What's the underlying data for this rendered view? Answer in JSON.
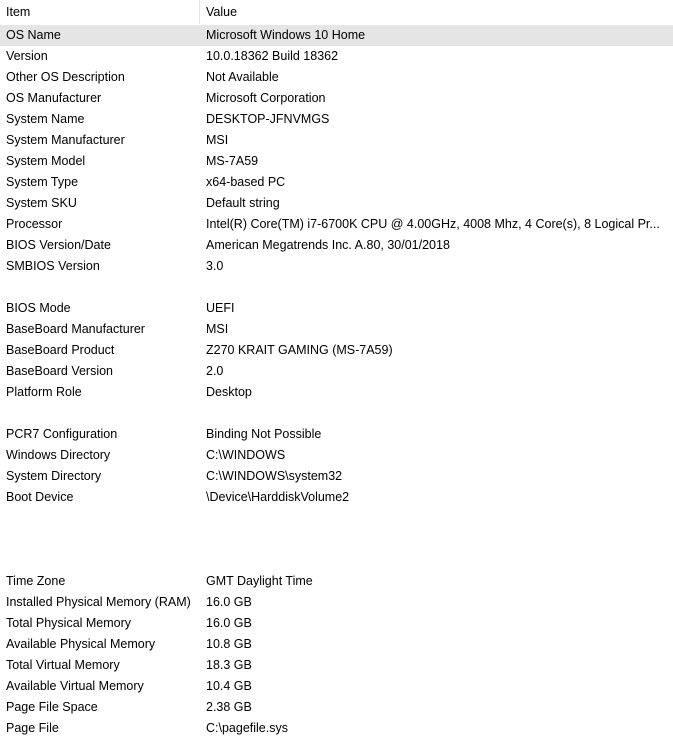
{
  "header": {
    "item": "Item",
    "value": "Value"
  },
  "rows": [
    {
      "item": "OS Name",
      "value": "Microsoft Windows 10 Home"
    },
    {
      "item": "Version",
      "value": "10.0.18362 Build 18362"
    },
    {
      "item": "Other OS Description",
      "value": "Not Available"
    },
    {
      "item": "OS Manufacturer",
      "value": "Microsoft Corporation"
    },
    {
      "item": "System Name",
      "value": "DESKTOP-JFNVMGS"
    },
    {
      "item": "System Manufacturer",
      "value": "MSI"
    },
    {
      "item": "System Model",
      "value": "MS-7A59"
    },
    {
      "item": "System Type",
      "value": "x64-based PC"
    },
    {
      "item": "System SKU",
      "value": "Default string"
    },
    {
      "item": "Processor",
      "value": "Intel(R) Core(TM) i7-6700K CPU @ 4.00GHz, 4008 Mhz, 4 Core(s), 8 Logical Pr..."
    },
    {
      "item": "BIOS Version/Date",
      "value": "American Megatrends Inc. A.80, 30/01/2018"
    },
    {
      "item": "SMBIOS Version",
      "value": "3.0"
    },
    {
      "item": "",
      "value": ""
    },
    {
      "item": "BIOS Mode",
      "value": "UEFI"
    },
    {
      "item": "BaseBoard Manufacturer",
      "value": "MSI"
    },
    {
      "item": "BaseBoard Product",
      "value": "Z270 KRAIT GAMING (MS-7A59)"
    },
    {
      "item": "BaseBoard Version",
      "value": "2.0"
    },
    {
      "item": "Platform Role",
      "value": "Desktop"
    },
    {
      "item": "",
      "value": ""
    },
    {
      "item": "PCR7 Configuration",
      "value": "Binding Not Possible"
    },
    {
      "item": "Windows Directory",
      "value": "C:\\WINDOWS"
    },
    {
      "item": "System Directory",
      "value": "C:\\WINDOWS\\system32"
    },
    {
      "item": "Boot Device",
      "value": "\\Device\\HarddiskVolume2"
    },
    {
      "item": "",
      "value": ""
    },
    {
      "item": "",
      "value": ""
    },
    {
      "item": "",
      "value": ""
    },
    {
      "item": "Time Zone",
      "value": "GMT Daylight Time"
    },
    {
      "item": "Installed Physical Memory (RAM)",
      "value": "16.0 GB"
    },
    {
      "item": "Total Physical Memory",
      "value": "16.0 GB"
    },
    {
      "item": "Available Physical Memory",
      "value": "10.8 GB"
    },
    {
      "item": "Total Virtual Memory",
      "value": "18.3 GB"
    },
    {
      "item": "Available Virtual Memory",
      "value": "10.4 GB"
    },
    {
      "item": "Page File Space",
      "value": "2.38 GB"
    },
    {
      "item": "Page File",
      "value": "C:\\pagefile.sys"
    }
  ],
  "selected_row": 0
}
